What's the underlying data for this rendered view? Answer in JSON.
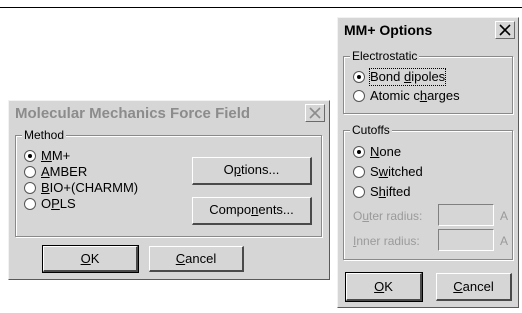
{
  "left_dialog": {
    "title": "Molecular Mechanics Force Field",
    "method_group": "Method",
    "methods": [
      {
        "pre": "",
        "key": "M",
        "post": "M+",
        "selected": true
      },
      {
        "pre": "",
        "key": "A",
        "post": "MBER",
        "selected": false
      },
      {
        "pre": "",
        "key": "B",
        "post": "IO+(CHARMM)",
        "selected": false
      },
      {
        "pre": "O",
        "key": "P",
        "post": "LS",
        "selected": false
      }
    ],
    "options_button": {
      "pre": "O",
      "key": "p",
      "post": "tions..."
    },
    "components_button": {
      "pre": "Compo",
      "key": "n",
      "post": "ents..."
    },
    "ok_button": {
      "pre": "",
      "key": "O",
      "post": "K"
    },
    "cancel_button": {
      "pre": "",
      "key": "C",
      "post": "ancel"
    }
  },
  "right_dialog": {
    "title": "MM+ Options",
    "electrostatic_group": "Electrostatic",
    "electrostatic": [
      {
        "pre": "Bond ",
        "key": "d",
        "post": "ipoles",
        "selected": true
      },
      {
        "pre": "Atomic c",
        "key": "h",
        "post": "arges",
        "selected": false
      }
    ],
    "cutoffs_group": "Cutoffs",
    "cutoffs": [
      {
        "pre": "",
        "key": "N",
        "post": "one",
        "selected": true
      },
      {
        "pre": "S",
        "key": "w",
        "post": "itched",
        "selected": false
      },
      {
        "pre": "S",
        "key": "h",
        "post": "ifted",
        "selected": false
      }
    ],
    "outer_radius": {
      "pre": "O",
      "key": "u",
      "post": "ter radius:",
      "value": "",
      "unit": "A"
    },
    "inner_radius": {
      "pre": "",
      "key": "I",
      "post": "nner radius:",
      "value": "",
      "unit": "A"
    },
    "ok_button": {
      "pre": "",
      "key": "O",
      "post": "K"
    },
    "cancel_button": {
      "pre": "",
      "key": "C",
      "post": "ancel"
    }
  }
}
